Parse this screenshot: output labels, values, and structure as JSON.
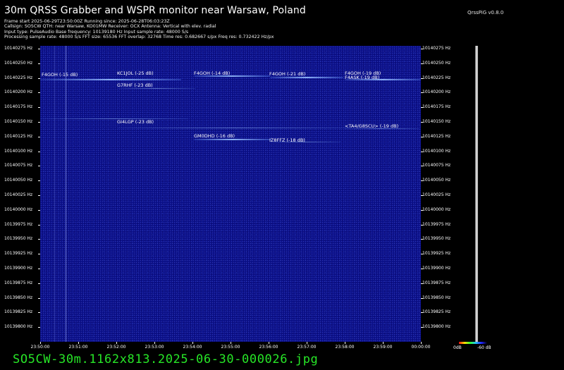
{
  "header": {
    "title": "30m QRSS Grabber and WSPR monitor near Warsaw, Poland",
    "version": "QrssPiG v0.8.0",
    "meta_lines": [
      "Frame start 2025-06-29T23:50:00Z Running since: 2025-06-28T06:03:23Z",
      "Callsign: SO5CW QTH: near Warsaw, KO01MW Receiver: OCX Antenna: Vertical with elev. radial",
      "Input type: PulseAudio Base frequency: 10139180 Hz Input sample rate: 48000 S/s",
      "Processing sample rate: 48000 S/s FFT size: 65536 FFT overlap: 32768 Time res: 0.682667 s/px Freq res: 0.732422 Hz/px"
    ]
  },
  "y_axis": {
    "ticks": [
      "10140275 Hz",
      "10140250 Hz",
      "10140225 Hz",
      "10140200 Hz",
      "10140175 Hz",
      "10140150 Hz",
      "10140125 Hz",
      "10140100 Hz",
      "10140075 Hz",
      "10140050 Hz",
      "10140025 Hz",
      "10140000 Hz",
      "10139975 Hz",
      "10139950 Hz",
      "10139925 Hz",
      "10139900 Hz",
      "10139875 Hz",
      "10139850 Hz",
      "10139825 Hz",
      "10139800 Hz"
    ]
  },
  "x_axis": {
    "ticks": [
      "23:50:00",
      "23:51:00",
      "23:52:00",
      "23:53:00",
      "23:54:00",
      "23:55:00",
      "23:56:00",
      "23:57:00",
      "23:58:00",
      "23:59:00",
      "00:00:00"
    ]
  },
  "spots": [
    {
      "label": "F4GOH (-15 dB)"
    },
    {
      "label": "KC1JOL (-25 dB)"
    },
    {
      "label": "F4GOH (-14 dB)"
    },
    {
      "label": "F4GOH (-21 dB)"
    },
    {
      "label": "F4GOH (-19 dB)"
    },
    {
      "label": "F4ASK (-19 dB)"
    },
    {
      "label": "G7RHF (-23 dB)"
    },
    {
      "label": "GI4LGP (-23 dB)"
    },
    {
      "label": "<TA4/G8SCU> (-19 dB)"
    },
    {
      "label": "GM0DHD (-16 dB)"
    },
    {
      "label": "IZ8FFZ (-18 dB)"
    }
  ],
  "colorbar": {
    "left_label": "0dB",
    "right_label": "-60 dB",
    "colors": [
      "#ff1010",
      "#ffdd00",
      "#30ff30",
      "#20c0ff",
      "#2020ff",
      "#000000"
    ]
  },
  "footer": {
    "filename": "SO5CW-30m.1162x813.2025-06-30-000026.jpg"
  },
  "colors": {
    "background": "#000000",
    "waterfall": "#0a0f86",
    "footer_text": "#27e627"
  }
}
